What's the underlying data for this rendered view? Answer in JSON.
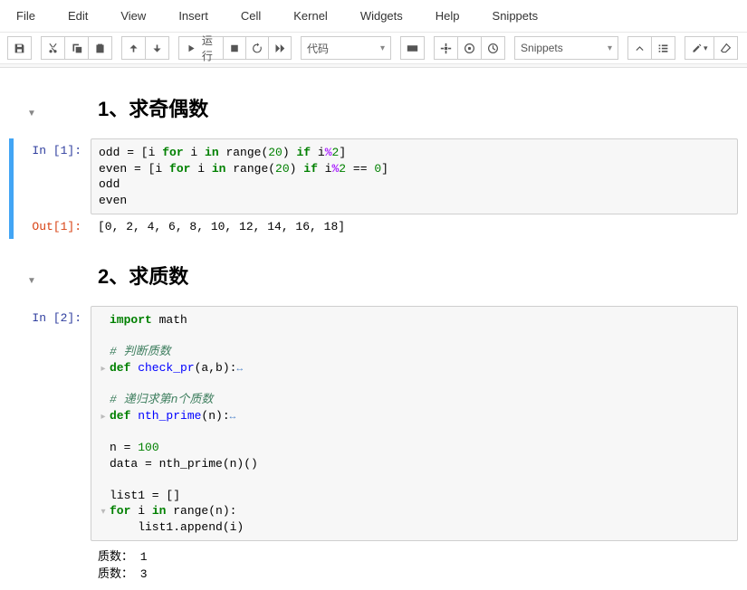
{
  "menu": {
    "items": [
      "File",
      "Edit",
      "View",
      "Insert",
      "Cell",
      "Kernel",
      "Widgets",
      "Help",
      "Snippets"
    ]
  },
  "toolbar": {
    "run_label": "运行",
    "celltype_select": "代码",
    "snippets_select": "Snippets"
  },
  "cells": {
    "h1": "1、求奇偶数",
    "h2": "2、求质数",
    "in1_prompt": "In  [1]:",
    "out1_prompt": "Out[1]:",
    "in2_prompt": "In  [2]:",
    "code1": {
      "l1a": "odd = [i ",
      "l1b": "for",
      "l1c": " i ",
      "l1d": "in",
      "l1e": " range(",
      "l1f": "20",
      "l1g": ") ",
      "l1h": "if",
      "l1i": " i",
      "l1j": "%",
      "l1k": "2",
      "l1l": "]",
      "l2a": "even = [i ",
      "l2b": "for",
      "l2c": " i ",
      "l2d": "in",
      "l2e": " range(",
      "l2f": "20",
      "l2g": ") ",
      "l2h": "if",
      "l2i": " i",
      "l2j": "%",
      "l2k": "2",
      "l2l": " == ",
      "l2m": "0",
      "l2n": "]",
      "l3": "odd",
      "l4": "even"
    },
    "out1": "[0, 2, 4, 6, 8, 10, 12, 14, 16, 18]",
    "code2": {
      "imp1": "import",
      "imp2": " math",
      "c1": "# 判断质数",
      "d1a": "def",
      "d1b": " check_pr",
      "d1c": "(a,b):",
      "c2": "# 递归求第n个质数",
      "d2a": "def",
      "d2b": " nth_prime",
      "d2c": "(n):",
      "n1a": "n = ",
      "n1b": "100",
      "n2": "data = nth_prime(n)()",
      "l1": "list1 = []",
      "f1a": "for",
      "f1b": " i ",
      "f1c": "in",
      "f1d": " range(n):",
      "f2": "    list1.append(i)"
    },
    "out2_l1": "质数： 1",
    "out2_l2": "质数： 3"
  }
}
